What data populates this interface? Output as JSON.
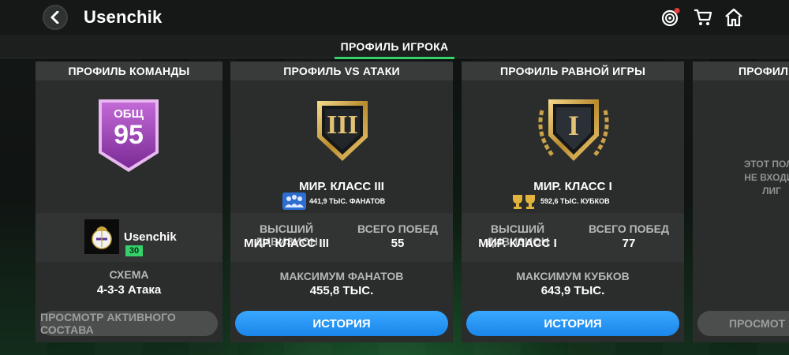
{
  "header": {
    "title": "Usenchik",
    "active_tab": "ПРОФИЛЬ ИГРОКА"
  },
  "icons": [
    "back-icon",
    "target-icon",
    "cart-icon",
    "home-icon"
  ],
  "colors": {
    "accent_green": "#35d16b",
    "button_blue": "#2196f3",
    "rating_purple": "#9b44b3",
    "gold": "#d8b45a"
  },
  "team_profile": {
    "title": "ПРОФИЛЬ КОМАНДЫ",
    "badge_label": "ОБЩ",
    "rating": "95",
    "manager_name": "Usenchik",
    "manager_level": "30",
    "formation_label": "СХЕМА",
    "formation_value": "4-3-3 Атака",
    "button_label": "ПРОСМОТР АКТИВНОГО СОСТАВА"
  },
  "vs_attack": {
    "title": "ПРОФИЛЬ VS АТАКИ",
    "emblem_text": "III",
    "division": "МИР. КЛАСС III",
    "fans_text": "441,9 ТЫС. ФАНАТОВ",
    "highest_division_label": "ВЫСШИЙ ДИВИЗИОН",
    "highest_division_value": "МИР. КЛАСС III",
    "total_wins_label": "ВСЕГО ПОБЕД",
    "total_wins_value": "55",
    "max_label": "МАКСИМУМ ФАНАТОВ",
    "max_value": "455,8 ТЫС.",
    "button_label": "ИСТОРИЯ"
  },
  "h2h": {
    "title": "ПРОФИЛЬ РАВНОЙ ИГРЫ",
    "emblem_text": "I",
    "division": "МИР. КЛАСС I",
    "cups_text": "592,6 ТЫС. КУБКОВ",
    "highest_division_label": "ВЫСШИЙ ДИВИЗИОН",
    "highest_division_value": "МИР. КЛАСС I",
    "total_wins_label": "ВСЕГО ПОБЕД",
    "total_wins_value": "77",
    "max_label": "МАКСИМУМ КУБКОВ",
    "max_value": "643,9 ТЫС.",
    "button_label": "ИСТОРИЯ"
  },
  "league_profile": {
    "title_partial": "ПРОФИЛ",
    "message_lines": [
      "ЭТОТ ПОЛЬ",
      "НЕ ВХОДИТ",
      "ЛИГ"
    ],
    "button_partial": "ПРОСМОТ"
  }
}
